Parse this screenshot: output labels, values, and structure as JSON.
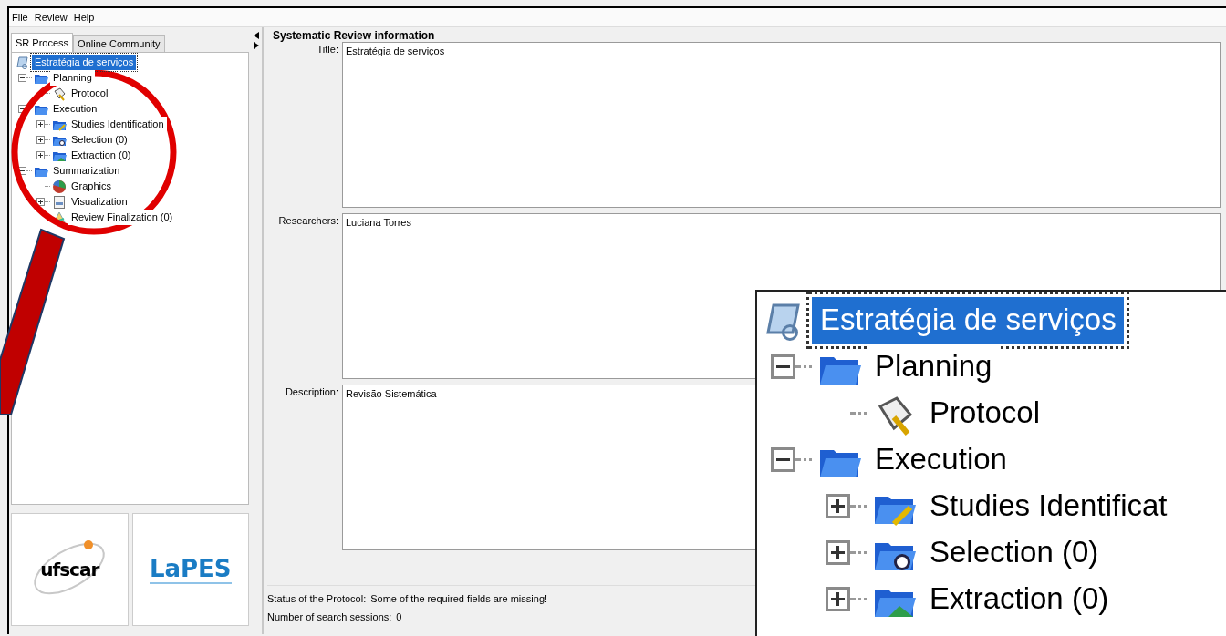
{
  "menu": [
    {
      "label": "File"
    },
    {
      "label": "Review"
    },
    {
      "label": "Help"
    }
  ],
  "tabs": [
    {
      "label": "SR Process",
      "selected": true
    },
    {
      "label": "Online Community",
      "selected": false
    }
  ],
  "tree": {
    "label": "Estratégia de serviços",
    "kind": "review",
    "selected": true,
    "children": [
      {
        "label": "Planning",
        "kind": "folder",
        "selected": false,
        "expanded": true,
        "children": [
          {
            "label": "Protocol",
            "kind": "protocol",
            "selected": false
          }
        ]
      },
      {
        "label": "Execution",
        "kind": "folder",
        "selected": false,
        "expanded": true,
        "children": [
          {
            "label": "Studies Identification",
            "kind": "identification",
            "selected": false,
            "expanded": false
          },
          {
            "label": "Selection (0)",
            "kind": "selection",
            "selected": false,
            "expanded": false
          },
          {
            "label": "Extraction (0)",
            "kind": "extraction",
            "selected": false,
            "expanded": false
          }
        ]
      },
      {
        "label": "Summarization",
        "kind": "folder",
        "selected": false,
        "expanded": true,
        "children": [
          {
            "label": "Graphics",
            "kind": "graphics",
            "selected": false
          },
          {
            "label": "Visualization",
            "kind": "visualization",
            "selected": false,
            "expanded": false
          },
          {
            "label": "Review Finalization (0)",
            "kind": "finalization",
            "selected": false
          }
        ]
      }
    ]
  },
  "logos": [
    {
      "kind": "ufscar",
      "text": "ufscar"
    },
    {
      "kind": "lapes",
      "text": "LaPES"
    }
  ],
  "form": {
    "title": "Systematic Review information",
    "fields": [
      {
        "label": "Title:",
        "value": "Estratégia de serviços"
      },
      {
        "label": "Researchers:",
        "value": "Luciana Torres"
      },
      {
        "label": "Description:",
        "value": "Revisão Sistemática"
      }
    ]
  },
  "status": [
    {
      "label": "Status of the Protocol:",
      "value": "Some of the required fields are missing!"
    },
    {
      "label": "Number of search sessions:",
      "value": "0"
    }
  ],
  "magnified_inset": {
    "tree": {
      "label": "Estratégia de serviços",
      "kind": "review",
      "selected": true,
      "children": [
        {
          "label": "Planning",
          "kind": "folder",
          "selected": false,
          "expanded": true,
          "children": [
            {
              "label": "Protocol",
              "kind": "protocol",
              "selected": false
            }
          ]
        },
        {
          "label": "Execution",
          "kind": "folder",
          "selected": false,
          "expanded": true,
          "children": [
            {
              "label": "Studies Identificat",
              "kind": "identification",
              "selected": false,
              "expanded": false
            },
            {
              "label": "Selection (0)",
              "kind": "selection",
              "selected": false,
              "expanded": false
            },
            {
              "label": "Extraction (0)",
              "kind": "extraction",
              "selected": false,
              "expanded": false
            }
          ]
        }
      ]
    }
  }
}
